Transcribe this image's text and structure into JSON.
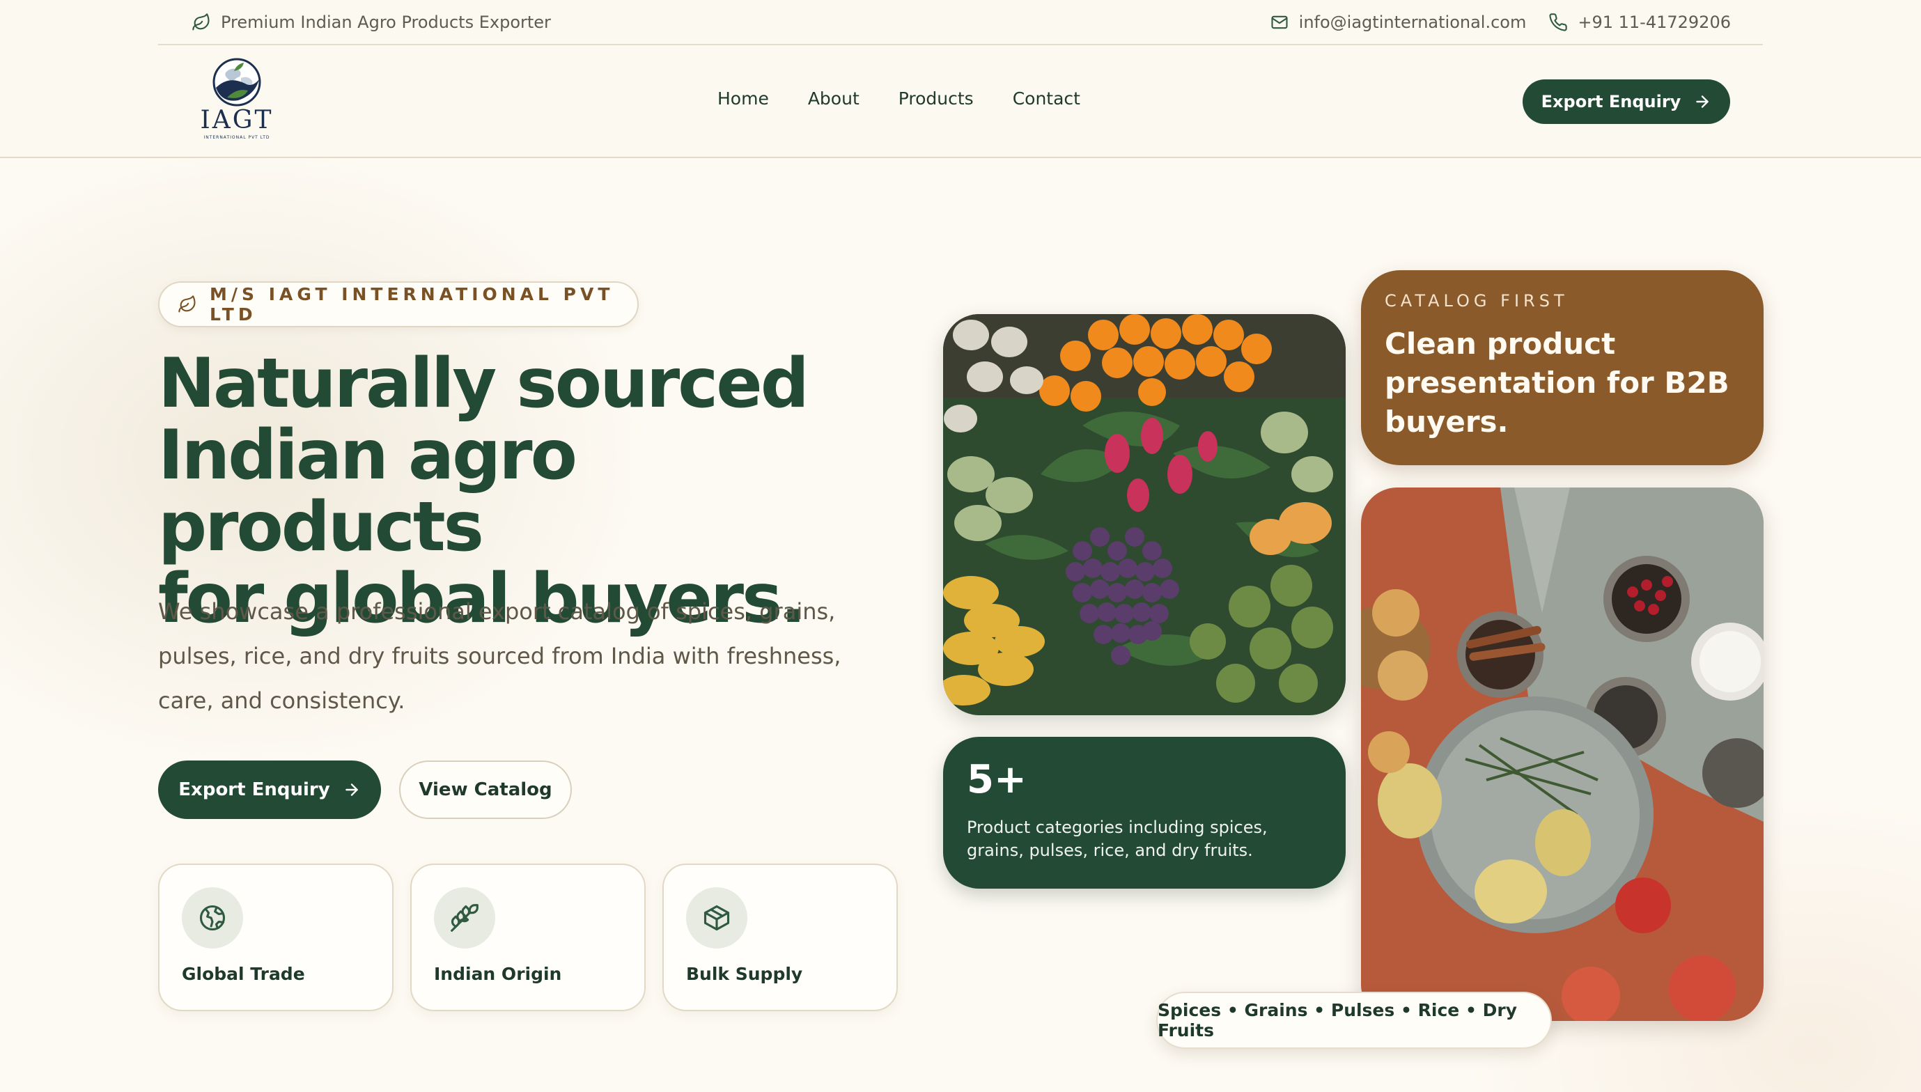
{
  "topbar": {
    "tagline": "Premium Indian Agro Products Exporter",
    "email": "info@iagtinternational.com",
    "phone": "+91 11-41729206"
  },
  "logo": {
    "name": "IAGT",
    "subtitle": "INTERNATIONAL PVT LTD"
  },
  "nav": {
    "items": [
      "Home",
      "About",
      "Products",
      "Contact"
    ]
  },
  "header": {
    "cta_label": "Export Enquiry"
  },
  "hero": {
    "badge": "M/S IAGT INTERNATIONAL PVT LTD",
    "title_line1": "Naturally sourced",
    "title_line2": "Indian agro products",
    "title_line3": "for global buyers.",
    "description": "We showcase a professional export catalog of spices, grains, pulses, rice, and dry fruits sourced from India with freshness, care, and consistency.",
    "primary_cta": "Export Enquiry",
    "secondary_cta": "View Catalog"
  },
  "features": [
    {
      "label": "Global Trade",
      "icon": "globe-icon"
    },
    {
      "label": "Indian Origin",
      "icon": "wheat-icon"
    },
    {
      "label": "Bulk Supply",
      "icon": "package-icon"
    }
  ],
  "catalog_card": {
    "eyebrow": "CATALOG FIRST",
    "title": "Clean product presentation for B2B buyers."
  },
  "stat_card": {
    "number": "5+",
    "description": "Product categories including spices, grains, pulses, rice, and dry fruits."
  },
  "categories_pill": "Spices • Grains • Pulses • Rice • Dry Fruits",
  "colors": {
    "primary_green": "#234a34",
    "brown": "#8a5a2b",
    "background": "#fcf9f1"
  }
}
